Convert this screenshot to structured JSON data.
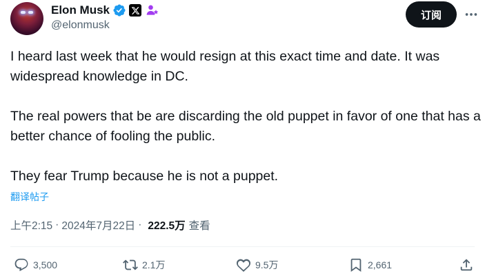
{
  "author": {
    "display_name": "Elon Musk",
    "handle": "@elonmusk",
    "verified_icon": "verified-badge-icon",
    "affiliation_icon": "x-logo-icon",
    "extra_icon": "people-icon"
  },
  "header": {
    "subscribe_label": "订阅",
    "more_icon": "more-horizontal-icon"
  },
  "post": {
    "paragraphs": [
      "I heard last week that he would resign at this exact time and date. It was widespread knowledge in DC.",
      "The real powers that be are discarding the old puppet in favor of one that has a better chance of fooling the public.",
      "They fear Trump because he is not a puppet."
    ],
    "translate_label": "翻译帖子"
  },
  "meta": {
    "time": "上午2:15",
    "separator": "·",
    "date": "2024年7月22日",
    "views_count": "222.5万",
    "views_label": "查看"
  },
  "actions": {
    "replies": "3,500",
    "reposts": "2.1万",
    "likes": "9.5万",
    "bookmarks": "2,661"
  },
  "colors": {
    "text_primary": "#0f1419",
    "text_secondary": "#536471",
    "link": "#1d9bf0",
    "verified": "#1d9bf0",
    "affiliation_purple": "#a23cf0",
    "button_bg": "#0f1419"
  }
}
